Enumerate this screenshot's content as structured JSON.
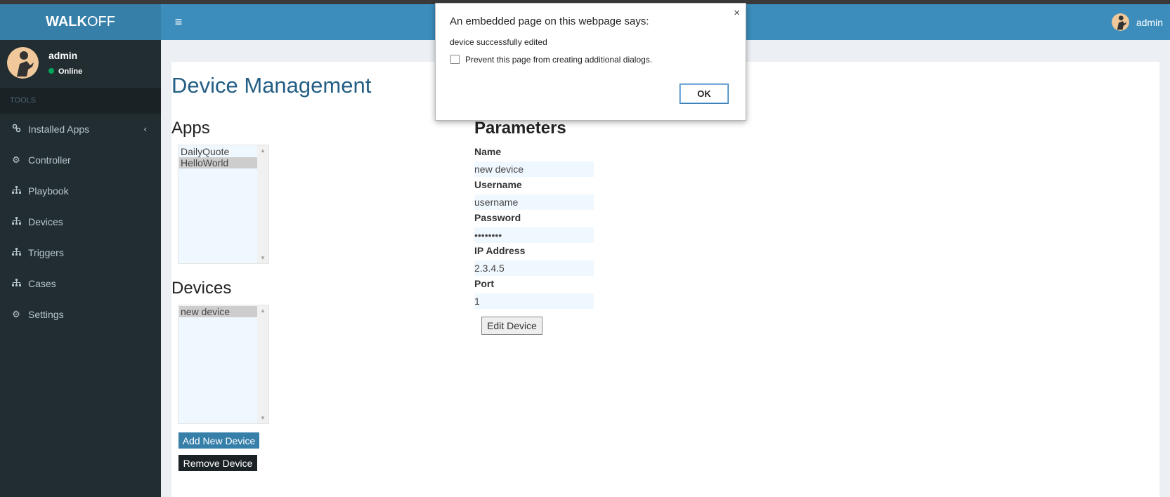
{
  "header": {
    "logo_bold": "WALK",
    "logo_light": "OFF",
    "menu_icon": "hamburger-icon",
    "user_name": "admin"
  },
  "sidebar": {
    "user": {
      "name": "admin",
      "status": "Online"
    },
    "section_label": "TOOLS",
    "items": [
      {
        "label": "Installed Apps",
        "icon": "link-icon"
      },
      {
        "label": "Controller",
        "icon": "gear-icon"
      },
      {
        "label": "Playbook",
        "icon": "sitemap-icon"
      },
      {
        "label": "Devices",
        "icon": "sitemap-icon"
      },
      {
        "label": "Triggers",
        "icon": "sitemap-icon"
      },
      {
        "label": "Cases",
        "icon": "sitemap-icon"
      },
      {
        "label": "Settings",
        "icon": "gear-icon"
      }
    ]
  },
  "main": {
    "title": "Device Management",
    "apps_heading": "Apps",
    "apps": [
      {
        "label": "DailyQuote",
        "selected": false
      },
      {
        "label": "HelloWorld",
        "selected": true
      }
    ],
    "devices_heading": "Devices",
    "devices": [
      {
        "label": "new device",
        "selected": true
      }
    ],
    "add_button": "Add New Device",
    "remove_button": "Remove Device",
    "params_heading": "Parameters",
    "params": {
      "name_label": "Name",
      "name_value": "new device",
      "username_label": "Username",
      "username_value": "username",
      "password_label": "Password",
      "password_value": "••••••••",
      "ip_label": "IP Address",
      "ip_value": "2.3.4.5",
      "port_label": "Port",
      "port_value": "1"
    },
    "edit_button": "Edit Device"
  },
  "dialog": {
    "title": "An embedded page on this webpage says:",
    "message": "device successfully edited",
    "checkbox_label": "Prevent this page from creating additional dialogs.",
    "checkbox_checked": false,
    "ok_label": "OK",
    "close_glyph": "×"
  },
  "colors": {
    "header": "#3c8dbc",
    "logo_bg": "#367fa9",
    "sidebar": "#222d32",
    "title": "#245e84",
    "online": "#00a65a"
  }
}
